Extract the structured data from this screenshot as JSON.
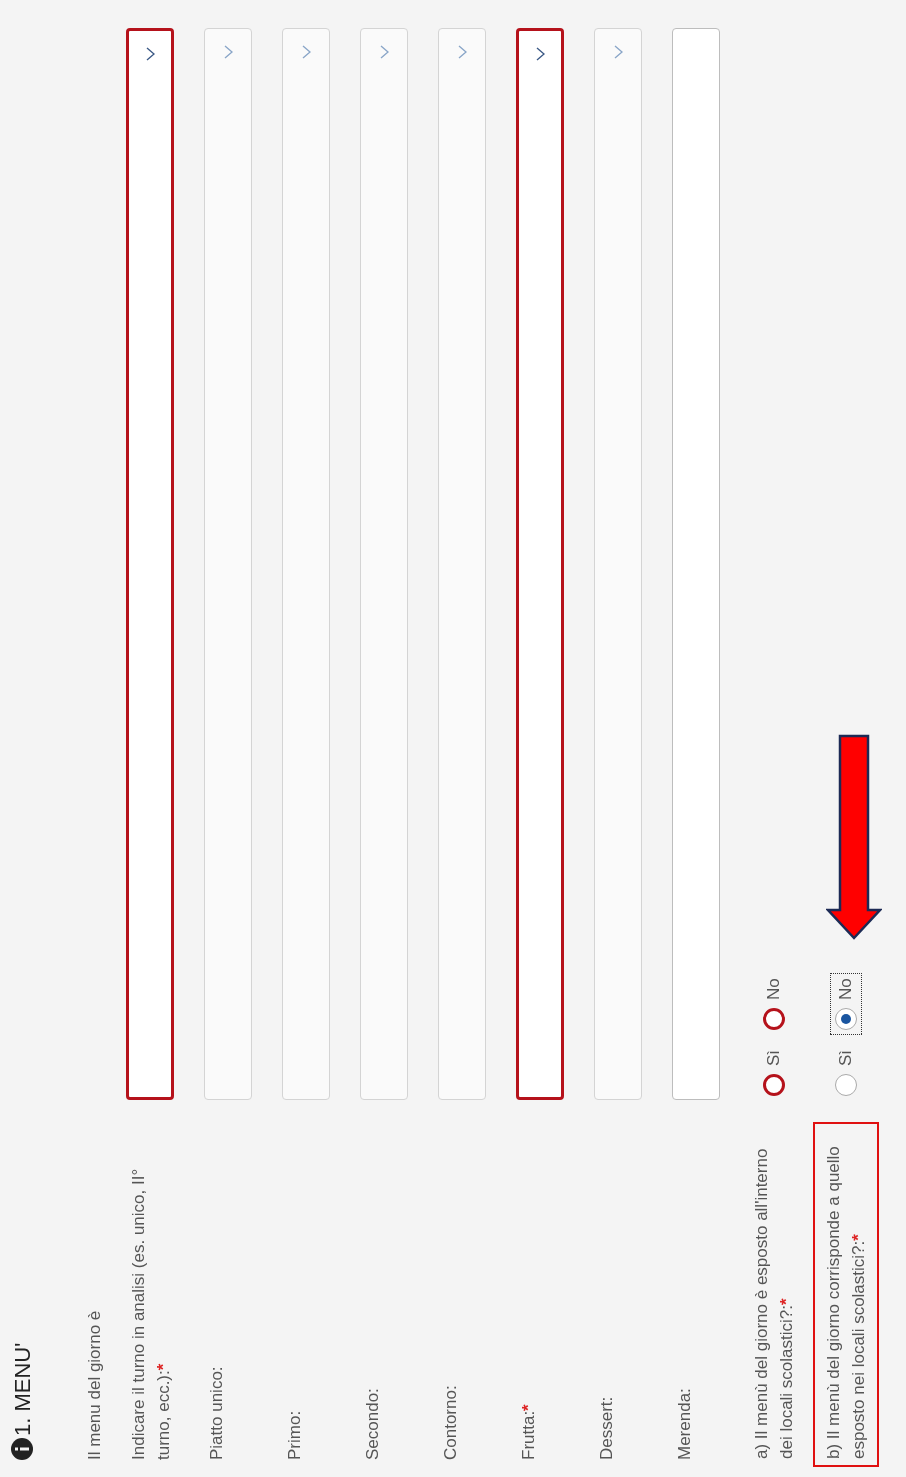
{
  "section": {
    "title": "1. MENU'"
  },
  "intro": "Il menu del giorno è",
  "fields": [
    {
      "kind": "select",
      "label": "Indicare il turno in analisi (es. unico, II° turno, ecc.):",
      "mark": "*",
      "error": true
    },
    {
      "kind": "select",
      "label": "Piatto unico:",
      "error": false
    },
    {
      "kind": "select",
      "label": "Primo:",
      "error": false
    },
    {
      "kind": "select",
      "label": "Secondo:",
      "error": false
    },
    {
      "kind": "select",
      "label": "Contorno:",
      "error": false
    },
    {
      "kind": "select",
      "label": "Frutta:",
      "mark": "*",
      "error": true
    },
    {
      "kind": "select",
      "label": "Dessert:",
      "error": false
    },
    {
      "kind": "text",
      "label": "Merenda:",
      "error": false
    }
  ],
  "questions": [
    {
      "label": "a) Il menù del giorno è esposto all'interno dei locali scolastici?:",
      "mark": "*",
      "error": true,
      "highlighted": false,
      "options": [
        {
          "label": "Sì",
          "selected": false,
          "focused": false
        },
        {
          "label": "No",
          "selected": false,
          "focused": false
        }
      ]
    },
    {
      "label": "b) Il menù del giorno corrisponde a quello esposto nei locali scolastici?:",
      "mark": "*",
      "error": false,
      "highlighted": true,
      "options": [
        {
          "label": "Sì",
          "selected": false,
          "focused": false
        },
        {
          "label": "No",
          "selected": true,
          "focused": true
        }
      ]
    }
  ],
  "arrow": true
}
